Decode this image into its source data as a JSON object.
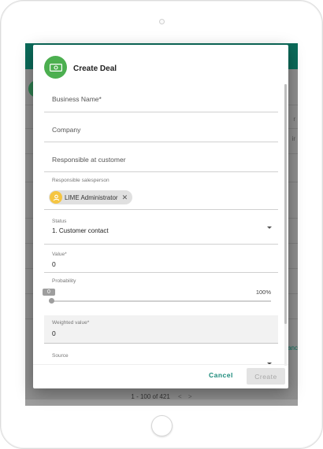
{
  "dialog": {
    "title": "Create Deal",
    "icon": "money-icon",
    "fields": {
      "business_name": {
        "placeholder": "Business Name*"
      },
      "company": {
        "placeholder": "Company"
      },
      "responsible_at_customer": {
        "placeholder": "Responsible at customer"
      },
      "responsible_salesperson": {
        "label": "Responsible salesperson",
        "chip_text": "LIME Administrator",
        "chip_remove": "✕"
      },
      "status": {
        "label": "Status",
        "value": "1. Customer contact"
      },
      "value": {
        "label": "Value*",
        "value": "0"
      },
      "probability": {
        "label": "Probability",
        "value": "0",
        "max_label": "100%",
        "level": 0
      },
      "weighted_value": {
        "label": "Weighted value*",
        "value": "0"
      },
      "source": {
        "label": "Source"
      }
    },
    "footer": {
      "cancel_label": "Cancel",
      "create_label": "Create"
    }
  },
  "background": {
    "pager_text": "1 - 100 of 421",
    "pager_prev": "<",
    "pager_next": ">",
    "right_edge_texts": [
      "r",
      "ir"
    ],
    "link_fragment": "anc"
  },
  "colors": {
    "topbar": "#0b6b5a",
    "icon_bg": "#4caf50",
    "chip_avatar": "#f5c542",
    "cancel": "#1a8a7a",
    "create_disabled_bg": "#e3e3e3"
  }
}
